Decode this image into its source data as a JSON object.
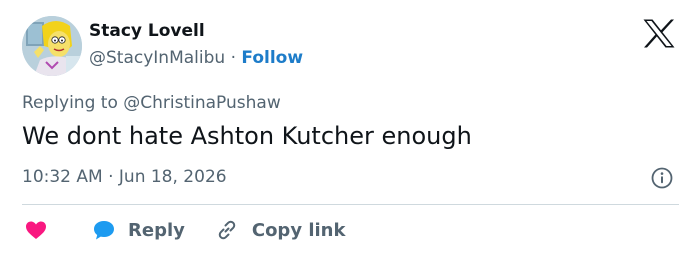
{
  "author": {
    "display_name": "Stacy Lovell",
    "handle": "@StacyInMalibu",
    "separator": "·",
    "follow_label": "Follow"
  },
  "tweet": {
    "reply_prefix": "Replying to ",
    "reply_to": "@ChristinaPushaw",
    "text": "We dont hate Ashton Kutcher enough",
    "timestamp": "10:32 AM · Jun 18, 2026"
  },
  "actions": {
    "reply_label": "Reply",
    "copy_link_label": "Copy link"
  },
  "icons": {
    "logo": "x-logo-icon",
    "info": "info-icon",
    "like": "heart-icon",
    "reply": "speech-bubble-icon",
    "copy_link": "link-icon"
  },
  "colors": {
    "follow": "#1d7cc9",
    "muted_text": "#536471",
    "heart": "#f91880",
    "reply_bubble": "#1d9bf0"
  }
}
